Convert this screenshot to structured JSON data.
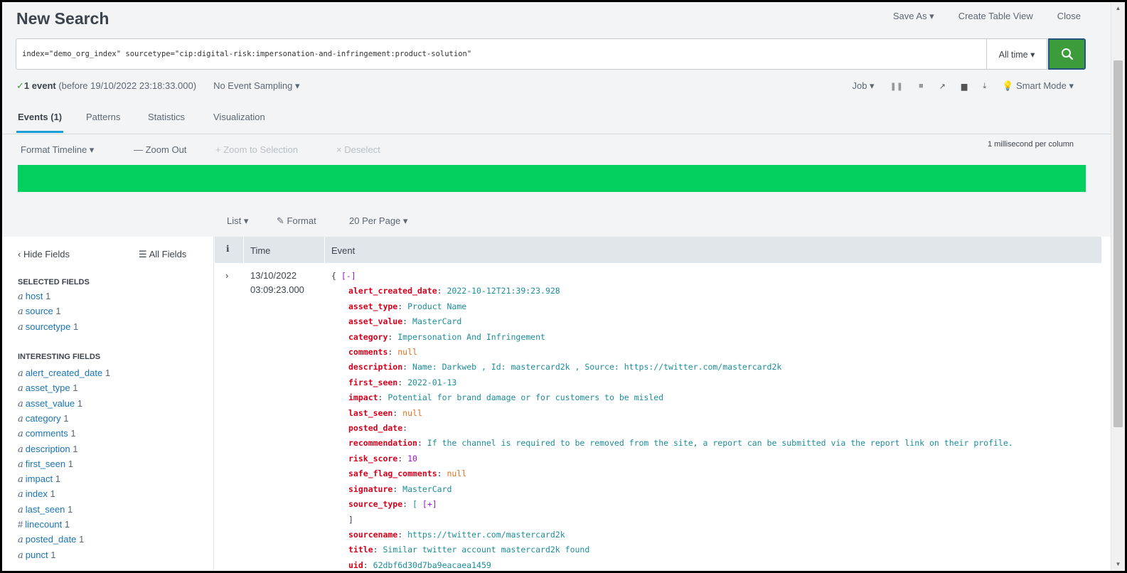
{
  "header": {
    "title": "New Search",
    "save_as": "Save As ▾",
    "create_table_view": "Create Table View",
    "close": "Close"
  },
  "search": {
    "query": "index=\"demo_org_index\" sourcetype=\"cip:digital-risk:impersonation-and-infringement:product-solution\"",
    "time_range": "All time ▾"
  },
  "status": {
    "check": "✓",
    "count": "1 event",
    "before": "(before 19/10/2022 23:18:33.000)",
    "sampling": "No Event Sampling ▾",
    "job": "Job ▾",
    "mode": "Smart Mode ▾"
  },
  "tabs": [
    {
      "label": "Events (1)"
    },
    {
      "label": "Patterns"
    },
    {
      "label": "Statistics"
    },
    {
      "label": "Visualization"
    }
  ],
  "timeline": {
    "format": "Format Timeline ▾",
    "zoom_out": "— Zoom Out",
    "zoom_selection": "+ Zoom to Selection",
    "deselect": "× Deselect",
    "scale": "1 millisecond per column",
    "bar_color": "#02d15f"
  },
  "list_controls": {
    "list": "List ▾",
    "format": "Format",
    "per_page": "20 Per Page ▾"
  },
  "sidebar": {
    "hide": "‹ Hide Fields",
    "all": "All Fields",
    "selected_title": "SELECTED FIELDS",
    "selected": [
      {
        "type": "a",
        "name": "host",
        "count": "1"
      },
      {
        "type": "a",
        "name": "source",
        "count": "1"
      },
      {
        "type": "a",
        "name": "sourcetype",
        "count": "1"
      }
    ],
    "interesting_title": "INTERESTING FIELDS",
    "interesting": [
      {
        "type": "a",
        "name": "alert_created_date",
        "count": "1"
      },
      {
        "type": "a",
        "name": "asset_type",
        "count": "1"
      },
      {
        "type": "a",
        "name": "asset_value",
        "count": "1"
      },
      {
        "type": "a",
        "name": "category",
        "count": "1"
      },
      {
        "type": "a",
        "name": "comments",
        "count": "1"
      },
      {
        "type": "a",
        "name": "description",
        "count": "1"
      },
      {
        "type": "a",
        "name": "first_seen",
        "count": "1"
      },
      {
        "type": "a",
        "name": "impact",
        "count": "1"
      },
      {
        "type": "a",
        "name": "index",
        "count": "1"
      },
      {
        "type": "a",
        "name": "last_seen",
        "count": "1"
      },
      {
        "type": "#",
        "name": "linecount",
        "count": "1"
      },
      {
        "type": "a",
        "name": "posted_date",
        "count": "1"
      },
      {
        "type": "a",
        "name": "punct",
        "count": "1"
      }
    ]
  },
  "table": {
    "col_i": "i",
    "col_time": "Time",
    "col_event": "Event",
    "expander": "›",
    "row_date": "13/10/2022",
    "row_time": "03:09:23.000",
    "event_open": "{ ",
    "collapse": "[-]",
    "expand": "[+]",
    "close_bracket": "]",
    "lines": [
      {
        "key": "alert_created_date",
        "value": "2022-10-12T21:39:23.928",
        "kind": "s"
      },
      {
        "key": "asset_type",
        "value": "Product Name",
        "kind": "s"
      },
      {
        "key": "asset_value",
        "value": "MasterCard",
        "kind": "s"
      },
      {
        "key": "category",
        "value": "Impersonation And Infringement",
        "kind": "s"
      },
      {
        "key": "comments",
        "value": "null",
        "kind": "null"
      },
      {
        "key": "description",
        "value": "Name: Darkweb , Id: mastercard2k , Source: https://twitter.com/mastercard2k",
        "kind": "s"
      },
      {
        "key": "first_seen",
        "value": "2022-01-13",
        "kind": "s"
      },
      {
        "key": "impact",
        "value": "Potential for brand damage or for customers to be misled",
        "kind": "s"
      },
      {
        "key": "last_seen",
        "value": "null",
        "kind": "null"
      },
      {
        "key": "posted_date",
        "value": "",
        "kind": "s"
      },
      {
        "key": "recommendation",
        "value": "If the channel is required to be removed from the site, a report can be submitted via the report link on their profile.",
        "kind": "s"
      },
      {
        "key": "risk_score",
        "value": "10",
        "kind": "n"
      },
      {
        "key": "safe_flag_comments",
        "value": "null",
        "kind": "null"
      },
      {
        "key": "signature",
        "value": "MasterCard",
        "kind": "s"
      },
      {
        "key": "source_type",
        "value": "[ ",
        "kind": "arr"
      },
      {
        "key": "sourcename",
        "value": "https://twitter.com/mastercard2k",
        "kind": "s"
      },
      {
        "key": "title",
        "value": "Similar twitter account mastercard2k found",
        "kind": "s"
      },
      {
        "key": "uid",
        "value": "62dbf6d30d7ba9eacaea1459",
        "kind": "s"
      }
    ]
  }
}
